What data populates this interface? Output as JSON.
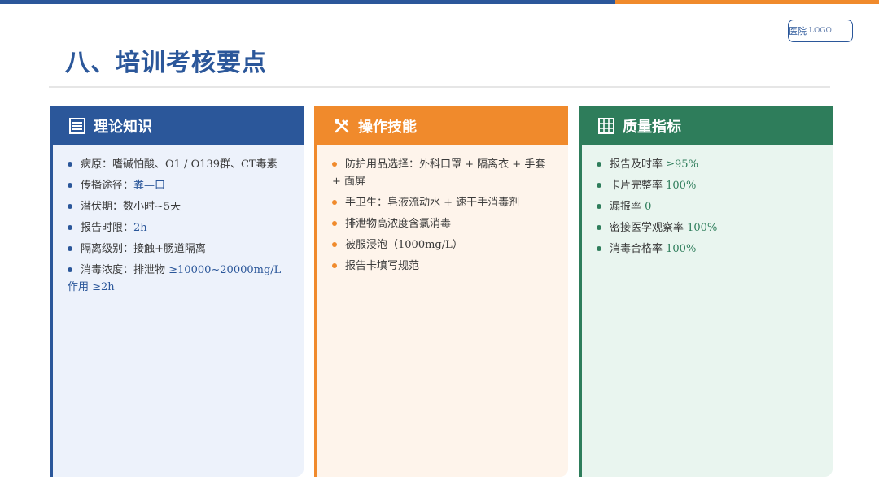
{
  "header": {
    "logo_cn": "医院",
    "logo_en": "LOGO",
    "title": "八、培训考核要点"
  },
  "colors": {
    "blue": "#2b579a",
    "orange": "#f08a2c",
    "green": "#2e7d5b"
  },
  "cards": [
    {
      "title": "理论知识",
      "icon": "list-icon",
      "items": [
        {
          "text": "病原：嗜碱怕酸、O1 / O139群、CT毒素",
          "value": ""
        },
        {
          "text": "传播途径：",
          "value": "粪—口"
        },
        {
          "text": "潜伏期：数小时~5天",
          "value": ""
        },
        {
          "text": "报告时限：",
          "value": "2h"
        },
        {
          "text": "隔离级别：接触+肠道隔离",
          "value": ""
        },
        {
          "text": "消毒浓度：排泄物 ",
          "value": "≥10000~20000mg/L 作用 ≥2h"
        }
      ]
    },
    {
      "title": "操作技能",
      "icon": "tools-icon",
      "items": [
        {
          "text": "防护用品选择：外科口罩 + 隔离衣 + 手套 + 面屏"
        },
        {
          "text": "手卫生：皂液流动水 + 速干手消毒剂"
        },
        {
          "text": "排泄物高浓度含氯消毒"
        },
        {
          "text": "被服浸泡（1000mg/L）"
        },
        {
          "text": "报告卡填写规范"
        }
      ]
    },
    {
      "title": "质量指标",
      "icon": "grid-icon",
      "items": [
        {
          "text": "报告及时率 ",
          "value": "≥95%"
        },
        {
          "text": "卡片完整率 ",
          "value": "100%"
        },
        {
          "text": "漏报率 ",
          "value": "0"
        },
        {
          "text": "密接医学观察率 ",
          "value": "100%"
        },
        {
          "text": "消毒合格率 ",
          "value": "100%"
        }
      ]
    }
  ]
}
